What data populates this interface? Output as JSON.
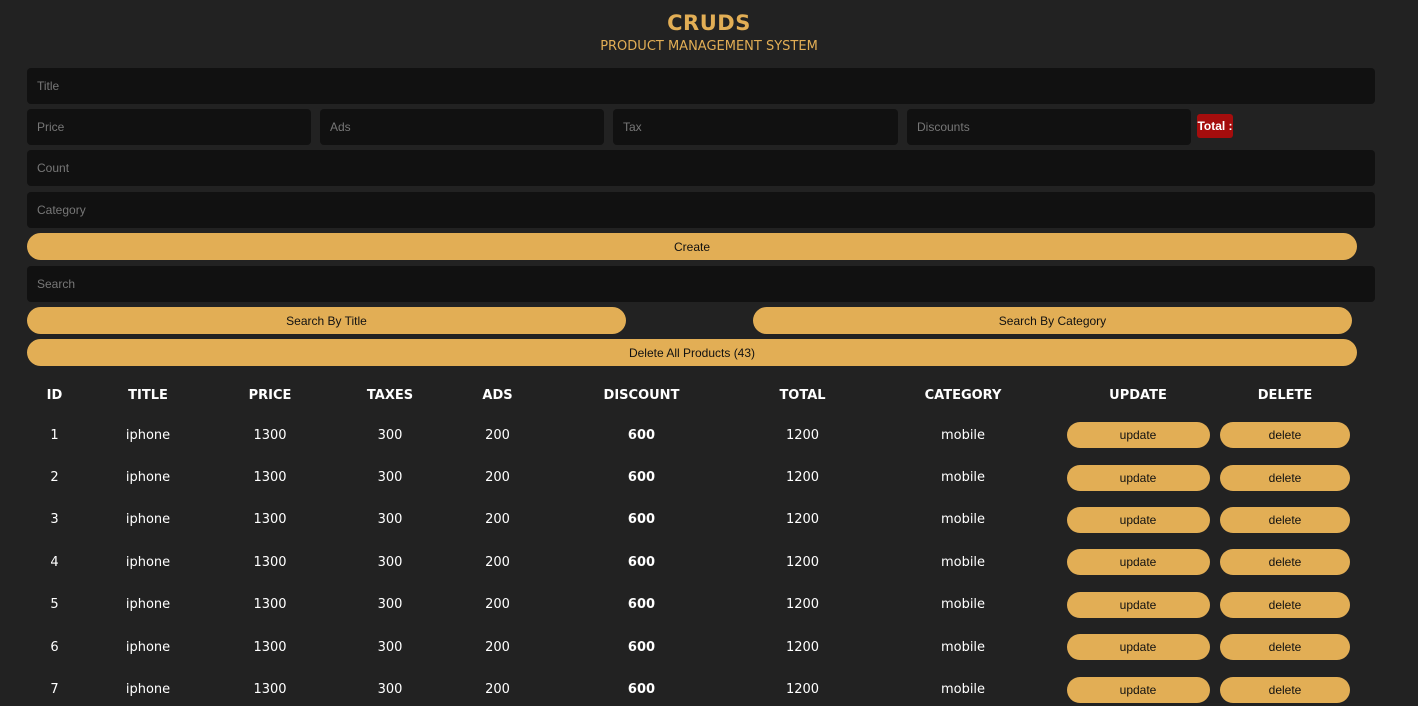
{
  "header": {
    "title": "CRUDS",
    "subtitle": "PRODUCT MANAGEMENT SYSTEM"
  },
  "form": {
    "title_placeholder": "Title",
    "price_placeholder": "Price",
    "ads_placeholder": "Ads",
    "tax_placeholder": "Tax",
    "discounts_placeholder": "Discounts",
    "total_label": "Total :",
    "count_placeholder": "Count",
    "category_placeholder": "Category",
    "create_label": "Create"
  },
  "search": {
    "placeholder": "Search",
    "by_title_label": "Search By Title",
    "by_category_label": "Search By Category",
    "delete_all_label": "Delete All Products (43)"
  },
  "table": {
    "headers": [
      "ID",
      "TITLE",
      "PRICE",
      "TAXES",
      "ADS",
      "DISCOUNT",
      "TOTAL",
      "CATEGORY",
      "UPDATE",
      "DELETE"
    ],
    "update_label": "update",
    "delete_label": "delete",
    "rows": [
      {
        "id": "1",
        "title": "iphone",
        "price": "1300",
        "taxes": "300",
        "ads": "200",
        "discount": "600",
        "total": "1200",
        "category": "mobile"
      },
      {
        "id": "2",
        "title": "iphone",
        "price": "1300",
        "taxes": "300",
        "ads": "200",
        "discount": "600",
        "total": "1200",
        "category": "mobile"
      },
      {
        "id": "3",
        "title": "iphone",
        "price": "1300",
        "taxes": "300",
        "ads": "200",
        "discount": "600",
        "total": "1200",
        "category": "mobile"
      },
      {
        "id": "4",
        "title": "iphone",
        "price": "1300",
        "taxes": "300",
        "ads": "200",
        "discount": "600",
        "total": "1200",
        "category": "mobile"
      },
      {
        "id": "5",
        "title": "iphone",
        "price": "1300",
        "taxes": "300",
        "ads": "200",
        "discount": "600",
        "total": "1200",
        "category": "mobile"
      },
      {
        "id": "6",
        "title": "iphone",
        "price": "1300",
        "taxes": "300",
        "ads": "200",
        "discount": "600",
        "total": "1200",
        "category": "mobile"
      },
      {
        "id": "7",
        "title": "iphone",
        "price": "1300",
        "taxes": "300",
        "ads": "200",
        "discount": "600",
        "total": "1200",
        "category": "mobile"
      }
    ]
  },
  "colors": {
    "background": "#222222",
    "input": "#111111",
    "accent": "#e2ae55",
    "total_badge": "#a50d0d"
  }
}
